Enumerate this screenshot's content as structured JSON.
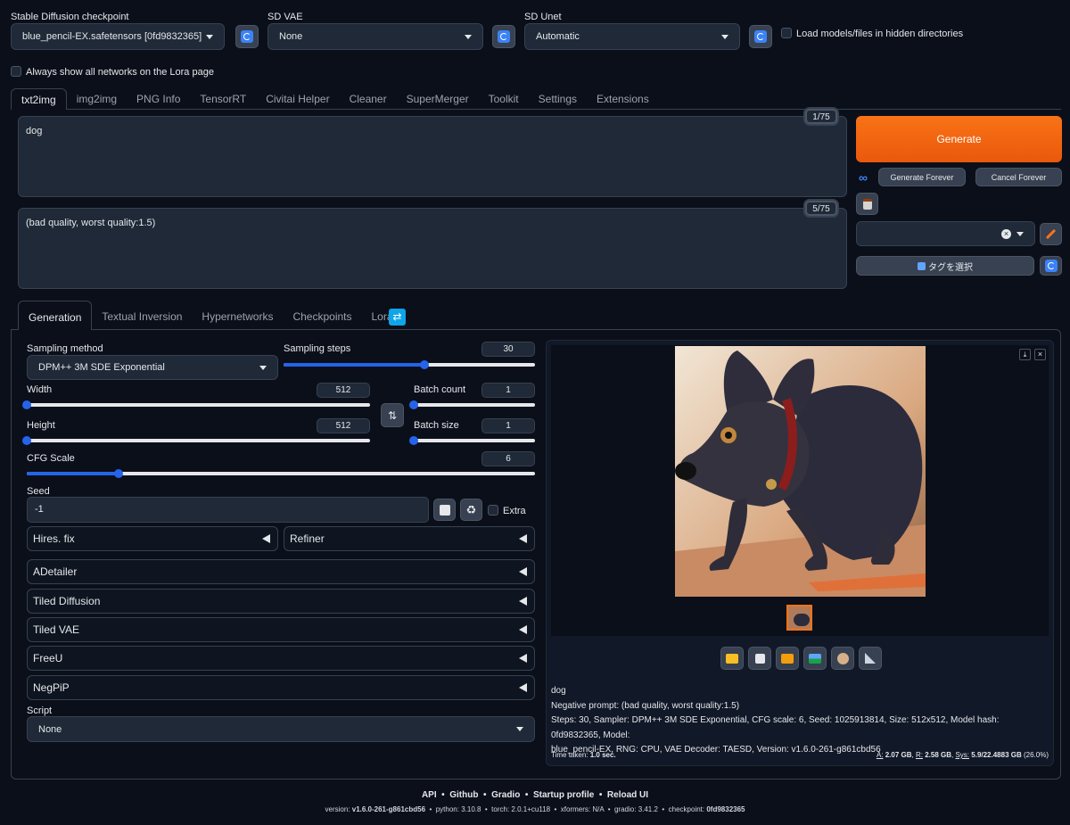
{
  "top": {
    "checkpoint": {
      "label": "Stable Diffusion checkpoint",
      "value": "blue_pencil-EX.safetensors [0fd9832365]"
    },
    "vae": {
      "label": "SD VAE",
      "value": "None"
    },
    "unet": {
      "label": "SD Unet",
      "value": "Automatic"
    },
    "hidden_dirs": "Load models/files in hidden directories",
    "lora_show": "Always show all networks on the Lora page"
  },
  "tabs": [
    "txt2img",
    "img2img",
    "PNG Info",
    "TensorRT",
    "Civitai Helper",
    "Cleaner",
    "SuperMerger",
    "Toolkit",
    "Settings",
    "Extensions"
  ],
  "prompt": {
    "text": "dog",
    "tokens": "1/75"
  },
  "negative": {
    "text": "(bad quality, worst quality:1.5)",
    "tokens": "5/75"
  },
  "actions": {
    "generate": "Generate",
    "forever": "Generate Forever",
    "cancel": "Cancel Forever",
    "tag_select": "タグを選択"
  },
  "subtabs": [
    "Generation",
    "Textual Inversion",
    "Hypernetworks",
    "Checkpoints",
    "Lora"
  ],
  "params": {
    "sampling_method": {
      "label": "Sampling method",
      "value": "DPM++ 3M SDE Exponential"
    },
    "sampling_steps": {
      "label": "Sampling steps",
      "value": "30",
      "fraction": 0.56
    },
    "width": {
      "label": "Width",
      "value": "512",
      "fraction": 0.0
    },
    "height": {
      "label": "Height",
      "value": "512",
      "fraction": 0.0
    },
    "batch_count": {
      "label": "Batch count",
      "value": "1",
      "fraction": 0.0
    },
    "batch_size": {
      "label": "Batch size",
      "value": "1",
      "fraction": 0.0
    },
    "cfg": {
      "label": "CFG Scale",
      "value": "6",
      "fraction": 0.18
    },
    "seed": {
      "label": "Seed",
      "value": "-1"
    },
    "extra": "Extra"
  },
  "accordions": {
    "hires": "Hires. fix",
    "refiner": "Refiner",
    "list": [
      "ADetailer",
      "Tiled Diffusion",
      "Tiled VAE",
      "FreeU",
      "NegPiP"
    ]
  },
  "script": {
    "label": "Script",
    "value": "None"
  },
  "output": {
    "prompt": "dog",
    "negative": "Negative prompt: (bad quality, worst quality:1.5)",
    "info1": "Steps: 30, Sampler: DPM++ 3M SDE Exponential, CFG scale: 6, Seed: 1025913814, Size: 512x512, Model hash: 0fd9832365, Model:",
    "info2": "blue_pencil-EX, RNG: CPU, VAE Decoder: TAESD, Version: v1.6.0-261-g861cbd56",
    "time_label": "Time taken:",
    "time_value": "1.0 sec.",
    "mem": {
      "a_label": "A:",
      "a": "2.07 GB",
      "r_label": "R:",
      "r": "2.58 GB",
      "sys_label": "Sys:",
      "sys": "5.9/22.4883 GB",
      "pct": "(26.0%)"
    }
  },
  "footer": {
    "links": [
      "API",
      "Github",
      "Gradio",
      "Startup profile",
      "Reload UI"
    ],
    "version_label": "version:",
    "version": "v1.6.0-261-g861cbd56",
    "python_label": "python:",
    "python": "3.10.8",
    "torch_label": "torch:",
    "torch": "2.0.1+cu118",
    "xformers_label": "xformers:",
    "xformers": "N/A",
    "gradio_label": "gradio:",
    "gradio": "3.41.2",
    "ckpt_label": "checkpoint:",
    "ckpt": "0fd9832365"
  },
  "colors": {
    "accent": "#f97316",
    "blue": "#2563eb",
    "bg": "#0b0f19"
  }
}
